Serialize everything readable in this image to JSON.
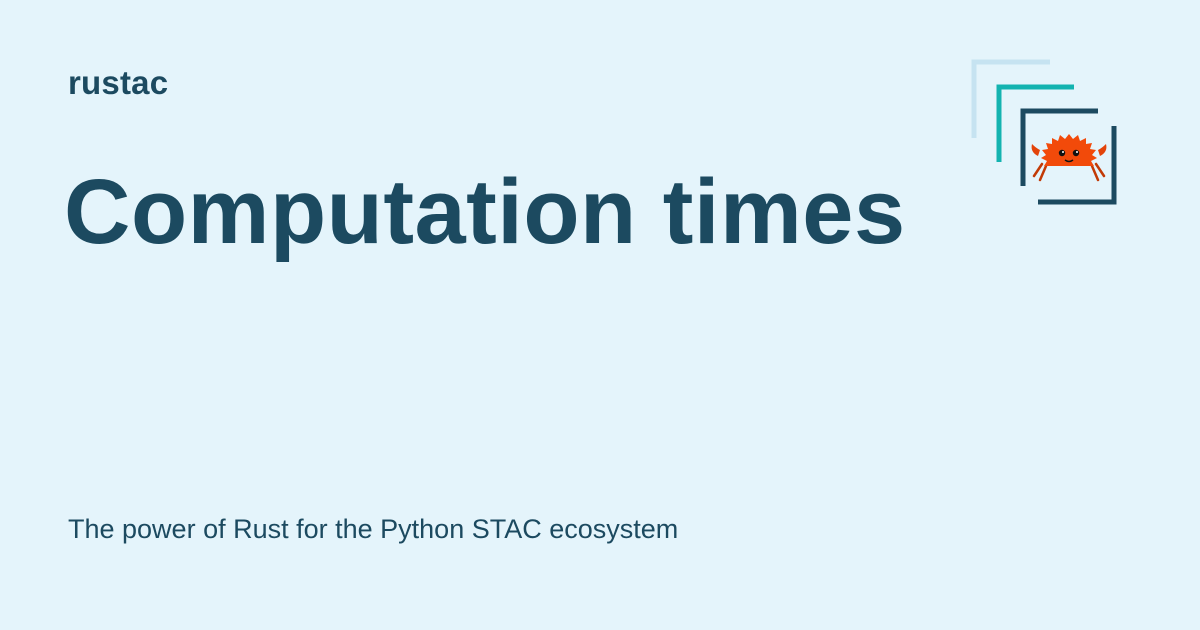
{
  "header": {
    "site_name": "rustac"
  },
  "main": {
    "title": "Computation times",
    "description": "The power of Rust for the Python STAC ecosystem"
  },
  "logo": {
    "icon": "stac-rust-crab-logo",
    "colors": {
      "outer_frame": "#c6e3f1",
      "middle_frame": "#13b3b0",
      "inner_frame": "#1c4a60",
      "crab": "#f24a0a"
    }
  },
  "colors": {
    "background": "#e4f4fb",
    "text": "#1c4a60"
  }
}
